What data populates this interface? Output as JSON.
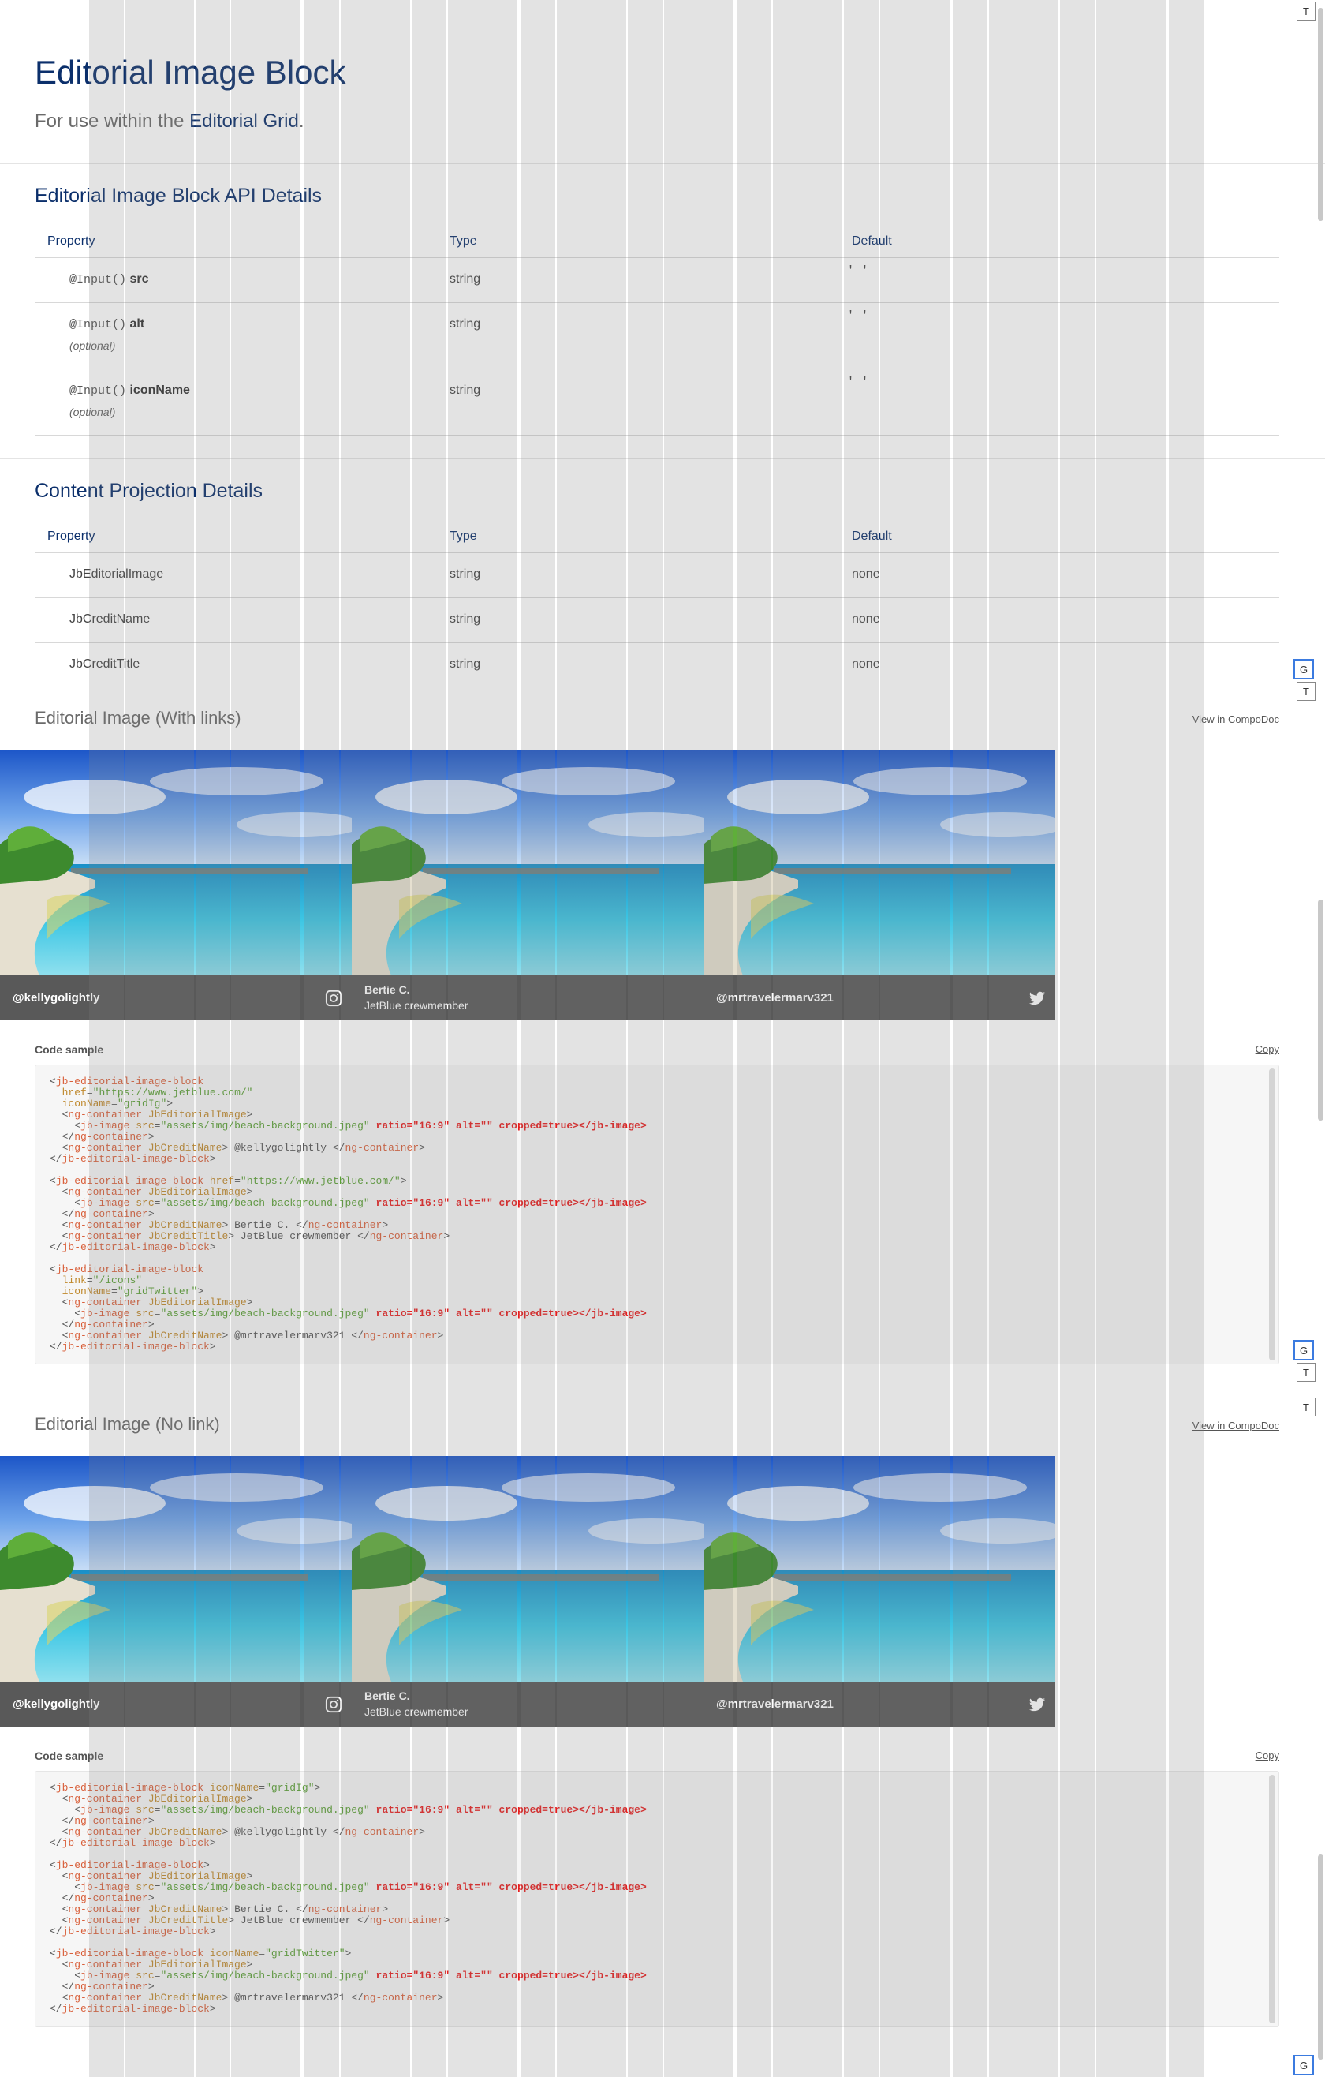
{
  "header": {
    "title": "Editorial Image Block",
    "subtitle_prefix": "For use within the ",
    "subtitle_link": "Editorial Grid",
    "subtitle_suffix": "."
  },
  "api": {
    "heading": "Editorial Image Block API Details",
    "columns": [
      "Property",
      "Type",
      "Default"
    ],
    "rows": [
      {
        "decorator": "@Input()",
        "name": "src",
        "optional": "",
        "type": "string",
        "default": "' '"
      },
      {
        "decorator": "@Input()",
        "name": "alt",
        "optional": "(optional)",
        "type": "string",
        "default": "' '"
      },
      {
        "decorator": "@Input()",
        "name": "iconName",
        "optional": "(optional)",
        "type": "string",
        "default": "' '"
      }
    ]
  },
  "projection": {
    "heading": "Content Projection Details",
    "columns": [
      "Property",
      "Type",
      "Default"
    ],
    "rows": [
      {
        "name": "JbEditorialImage",
        "type": "string",
        "default": "none"
      },
      {
        "name": "JbCreditName",
        "type": "string",
        "default": "none"
      },
      {
        "name": "JbCreditTitle",
        "type": "string",
        "default": "none"
      }
    ]
  },
  "demo_links": {
    "title": "Editorial Image (With links)",
    "compodoc": "View in CompoDoc",
    "tiles": [
      {
        "name": "@kellygolightly",
        "role": "",
        "icon": "instagram-icon"
      },
      {
        "name": "Bertie C.",
        "role": "JetBlue crewmember",
        "icon": ""
      },
      {
        "name": "@mrtravelermarv321",
        "role": "",
        "icon": "twitter-icon"
      }
    ],
    "code_label": "Code sample",
    "copy": "Copy"
  },
  "demo_nolink": {
    "title": "Editorial Image (No link)",
    "compodoc": "View in CompoDoc",
    "tiles": [
      {
        "name": "@kellygolightly",
        "role": "",
        "icon": "instagram-icon"
      },
      {
        "name": "Bertie C.",
        "role": "JetBlue crewmember",
        "icon": ""
      },
      {
        "name": "@mrtravelermarv321",
        "role": "",
        "icon": "twitter-icon"
      }
    ],
    "code_label": "Code sample",
    "copy": "Copy"
  },
  "markers": {
    "t": "T",
    "g": "G"
  },
  "colors": {
    "brand": "#0b2f6b",
    "credit_bar": "#595959",
    "code_bg": "#f6f6f6"
  }
}
